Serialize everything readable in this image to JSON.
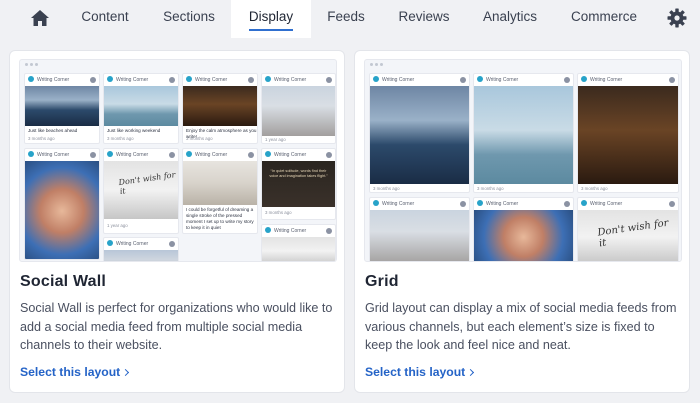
{
  "nav": {
    "tabs": [
      {
        "label": "Content"
      },
      {
        "label": "Sections"
      },
      {
        "label": "Display"
      },
      {
        "label": "Feeds"
      },
      {
        "label": "Reviews"
      },
      {
        "label": "Analytics"
      },
      {
        "label": "Commerce"
      }
    ],
    "active_tab": "Display",
    "accent_color": "#2f6fcf"
  },
  "preview_common": {
    "account_name": "Writing Corner",
    "time_label": "3 months ago",
    "time_label_short": "1 year ago"
  },
  "social_wall": {
    "title": "Social Wall",
    "description": "Social Wall is perfect for organizations who would like to add a social media feed from multiple social media channels to their website.",
    "link_label": "Select this layout",
    "captions": {
      "c1": "Just like beaches ahead",
      "c2": "Just like working weekend",
      "c3": "Enjoy the calm atmosphere as you write!",
      "c4": "I could be forgetful of dreaming a single stroke of the pressed moment I set up to write my story to keep it in quiet",
      "quote": "“In quiet solitude, words find their voice and imagination takes flight.”",
      "hand": "Don't wish for it"
    }
  },
  "grid": {
    "title": "Grid",
    "description": "Grid layout can display a mix of social media feeds from various channels, but each element’s size is fixed to keep the look and feel nice and neat.",
    "link_label": "Select this layout",
    "hand": "Don't wish for it"
  },
  "colors": {
    "link": "#2463c7",
    "avatar": "#27a3c9"
  }
}
